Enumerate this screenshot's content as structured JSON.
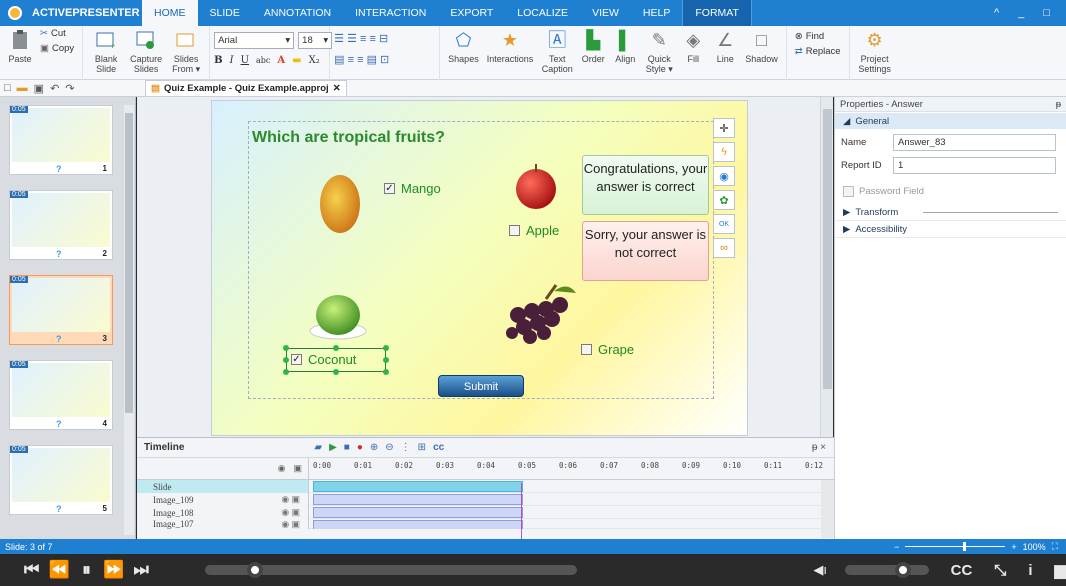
{
  "app": {
    "name": "ACTIVEPRESENTER",
    "window_controls": "^ _ □"
  },
  "menu": [
    "HOME",
    "SLIDE",
    "ANNOTATION",
    "INTERACTION",
    "EXPORT",
    "LOCALIZE",
    "VIEW",
    "HELP",
    "FORMAT"
  ],
  "ribbon": {
    "clipboard": {
      "paste": "Paste",
      "cut": "Cut",
      "copy": "Copy"
    },
    "slides": {
      "blank_slide": "Blank Slide",
      "capture_slides": "Capture Slides",
      "slides_from": "Slides From ▾"
    },
    "font": {
      "family": "Arial",
      "size": "18"
    },
    "insert": {
      "shapes": "Shapes",
      "interactions": "Interactions",
      "text_caption": "Text Caption",
      "order": "Order",
      "align": "Align",
      "quick_style": "Quick Style ▾",
      "fill": "Fill",
      "line": "Line",
      "shadow": "Shadow"
    },
    "find": "Find",
    "replace": "Replace",
    "project_settings": "Project Settings"
  },
  "document_tab": "Quiz Example - Quiz Example.approj",
  "slides_panel": [
    {
      "duration": "0:05",
      "q": "?",
      "num": "1",
      "selected": false
    },
    {
      "duration": "0:05",
      "q": "?",
      "num": "2",
      "selected": false
    },
    {
      "duration": "0:05",
      "q": "?",
      "num": "3",
      "selected": true
    },
    {
      "duration": "0:05",
      "q": "?",
      "num": "4",
      "selected": false
    },
    {
      "duration": "0:05",
      "q": "?",
      "num": "5",
      "selected": false
    }
  ],
  "slide": {
    "question": "Which are tropical fruits?",
    "answers": [
      {
        "label": "Mango",
        "checked": true
      },
      {
        "label": "Apple",
        "checked": false
      },
      {
        "label": "Coconut",
        "checked": true
      },
      {
        "label": "Grape",
        "checked": false
      }
    ],
    "feedback_correct": "Congratulations, your answer is correct",
    "feedback_incorrect": "Sorry, your answer is not correct",
    "submit": "Submit",
    "check_mark": "✓"
  },
  "properties": {
    "title": "Properties - Answer",
    "pin": "ᵽ",
    "general": "General",
    "name_label": "Name",
    "name_value": "Answer_83",
    "report_label": "Report ID",
    "report_value": "1",
    "password_field": "Password Field",
    "transform": "Transform",
    "accessibility": "Accessibility"
  },
  "timeline": {
    "title": "Timeline",
    "close": "ᵽ ×",
    "ticks": [
      "0:00",
      "0:01",
      "0:02",
      "0:03",
      "0:04",
      "0:05",
      "0:06",
      "0:07",
      "0:08",
      "0:09",
      "0:10",
      "0:11",
      "0:12"
    ],
    "rows": [
      "Slide",
      "Image_109",
      "Image_108",
      "Image_107"
    ]
  },
  "status": {
    "slide": "Slide: 3 of 7",
    "zoom": "100%"
  },
  "player": {
    "cc": "CC",
    "info": "i"
  },
  "colors": {
    "brand": "#1f7fd1",
    "question": "#2c8a2c",
    "answer": "#1f8a1f"
  }
}
